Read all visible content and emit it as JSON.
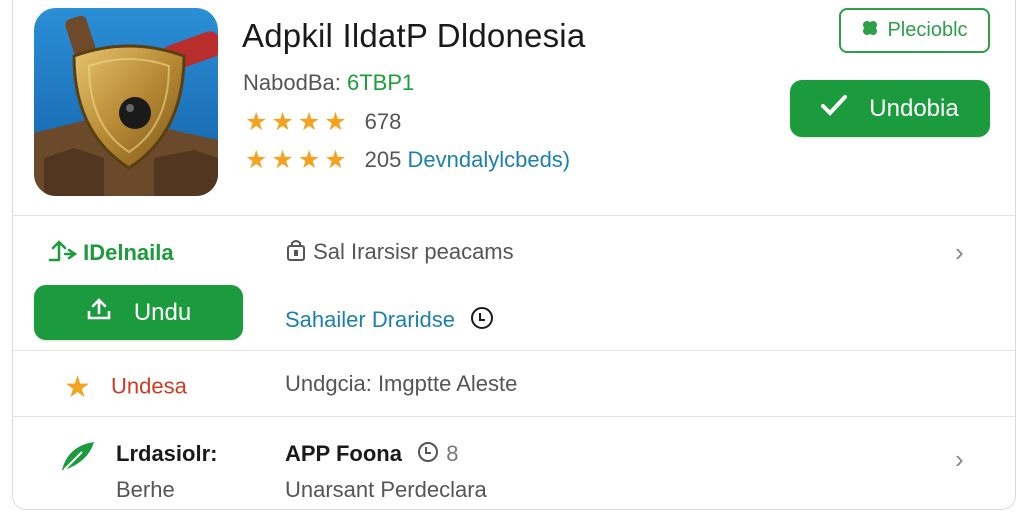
{
  "app": {
    "title": "Adpkil IldatP Dldonesia",
    "developer_label": "NabodBa:",
    "developer_code": "6TBP1",
    "rating_1": "678",
    "rating_2_count": "205",
    "rating_2_link": "Devndalylcbeds)"
  },
  "header_buttons": {
    "outline_label": "Plecioblc",
    "primary_label": "Undobia"
  },
  "rows": {
    "details_label": "IDelnaila",
    "permissions_label": "Sal Irarsisr peacams",
    "download_button_label": "Undu",
    "link_label": "Sahailer Draridse",
    "rate_label": "Undesa",
    "rate_desc": "Undgcia: Imgptte Aleste",
    "last_label": "Lrdasiolr:",
    "last_sub": "Berhe",
    "app_label": "APP Foona",
    "app_number": "8",
    "app_sub": "Unarsant Perdeclara"
  },
  "colors": {
    "green": "#1b9b3d",
    "star": "#f4a321",
    "link": "#1c7fb0",
    "red_text": "#d13a22"
  },
  "icons": [
    "clover-icon",
    "check-icon",
    "download-icon",
    "star-icon",
    "leaf-icon",
    "lock-icon",
    "clock-icon",
    "chevron-right-icon",
    "route-icon"
  ]
}
